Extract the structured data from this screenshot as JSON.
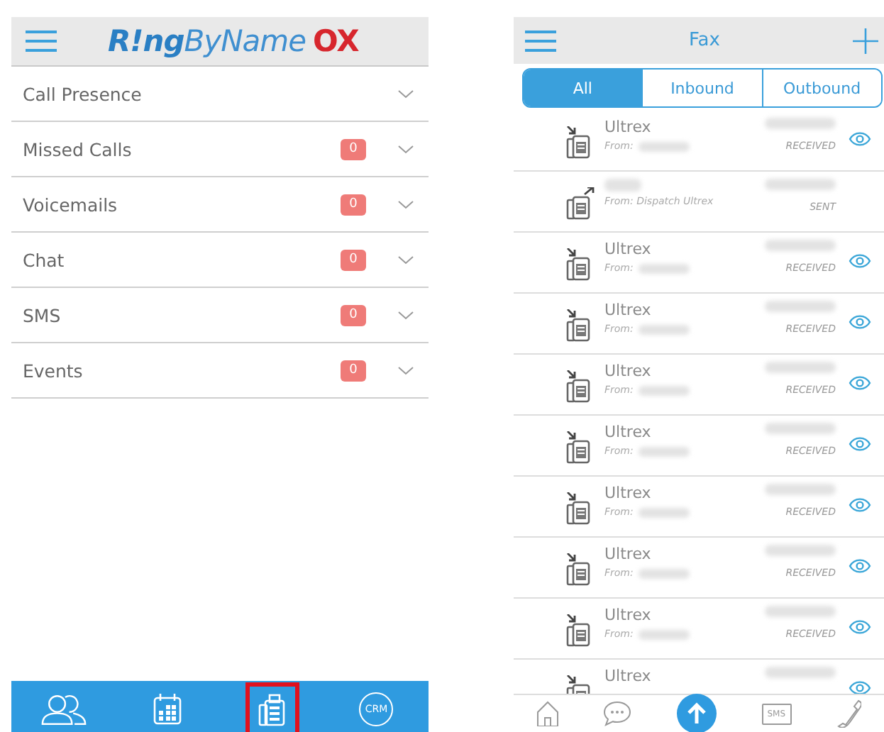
{
  "left": {
    "logo": {
      "ring": "R!ng",
      "byname": "ByName",
      "ox": "OX"
    },
    "sections": [
      {
        "label": "Call Presence"
      },
      {
        "label": "Missed Calls",
        "count": "0"
      },
      {
        "label": "Voicemails",
        "count": "0"
      },
      {
        "label": "Chat",
        "count": "0"
      },
      {
        "label": "SMS",
        "count": "0"
      },
      {
        "label": "Events",
        "count": "0"
      }
    ],
    "tabbar": [
      {
        "kind": "contacts",
        "selected": false
      },
      {
        "kind": "calendar",
        "selected": false
      },
      {
        "kind": "fax",
        "selected": true
      },
      {
        "kind": "crm",
        "label": "CRM",
        "selected": false
      }
    ]
  },
  "right": {
    "title": "Fax",
    "segments": [
      {
        "label": "All",
        "selected": true
      },
      {
        "label": "Inbound",
        "selected": false
      },
      {
        "label": "Outbound",
        "selected": false
      }
    ],
    "faxes": [
      {
        "kind": "received",
        "name": "Ultrex",
        "from": "From:",
        "sender_hidden": true,
        "status": "RECEIVED",
        "viewable": true
      },
      {
        "kind": "sent",
        "from": "From: Dispatch Ultrex",
        "sender_hidden": false,
        "status": "SENT",
        "viewable": false
      },
      {
        "kind": "received",
        "name": "Ultrex",
        "from": "From:",
        "sender_hidden": true,
        "status": "RECEIVED",
        "viewable": true
      },
      {
        "kind": "received",
        "name": "Ultrex",
        "from": "From:",
        "sender_hidden": true,
        "status": "RECEIVED",
        "viewable": true
      },
      {
        "kind": "received",
        "name": "Ultrex",
        "from": "From:",
        "sender_hidden": true,
        "status": "RECEIVED",
        "viewable": true
      },
      {
        "kind": "received",
        "name": "Ultrex",
        "from": "From:",
        "sender_hidden": true,
        "status": "RECEIVED",
        "viewable": true
      },
      {
        "kind": "received",
        "name": "Ultrex",
        "from": "From:",
        "sender_hidden": true,
        "status": "RECEIVED",
        "viewable": true
      },
      {
        "kind": "received",
        "name": "Ultrex",
        "from": "From:",
        "sender_hidden": true,
        "status": "RECEIVED",
        "viewable": true
      },
      {
        "kind": "received",
        "name": "Ultrex",
        "from": "From:",
        "sender_hidden": true,
        "status": "RECEIVED",
        "viewable": true
      },
      {
        "kind": "received",
        "name": "Ultrex",
        "viewable": true
      }
    ],
    "bottom_nav": [
      {
        "kind": "home"
      },
      {
        "kind": "chat"
      },
      {
        "kind": "upload"
      },
      {
        "kind": "sms",
        "label": "SMS"
      },
      {
        "kind": "phone"
      }
    ]
  }
}
